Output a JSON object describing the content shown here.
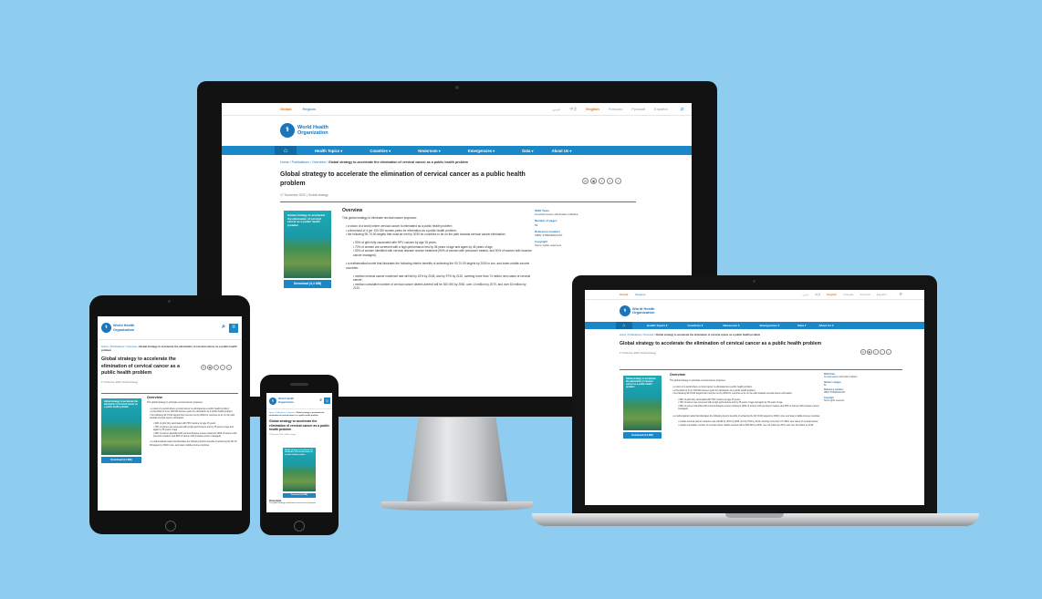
{
  "site": {
    "global_label": "Global",
    "regions_label": "Regions",
    "languages": [
      "عربي",
      "中文",
      "English",
      "Français",
      "Русский",
      "Español"
    ],
    "active_language": "English",
    "logo_line1": "World Health",
    "logo_line2": "Organization",
    "nav": [
      "Health Topics ▾",
      "Countries ▾",
      "Newsroom ▾",
      "Emergencies ▾",
      "Data ▾",
      "About Us ▾"
    ]
  },
  "page": {
    "breadcrumb_prefix": "Home / Publications / Overview / ",
    "breadcrumb_current": "Global strategy to accelerate the elimination of cervical cancer as a public health problem",
    "title": "Global strategy to accelerate the elimination of cervical cancer as a public health problem",
    "meta": "17 November 2020 | Global strategy",
    "cover_text": "Global strategy to accelerate the elimination of cervical cancer as a public health problem",
    "download_label": "Download (3,4 MB)",
    "overview_heading": "Overview",
    "overview_intro": "This global strategy to eliminate cervical cancer proposes:",
    "bullets": [
      "a vision of a world where cervical cancer is eliminated as a public health problem;",
      "a threshold of 4 per 100 000 women-years for elimination as a public health problem;",
      "the following 90-70-90 targets that must be met by 2030 for countries to be on the path towards cervical cancer elimination:"
    ],
    "sub_bullets": [
      "90% of girls fully vaccinated with HPV vaccine by age 15 years;",
      "70% of women are screened with a high-performance test by 35 years of age and again by 45 years of age",
      "90% of women identified with cervical disease receive treatment (90% of women with precancer treated, and 90% of women with invasive cancer managed)."
    ],
    "model_bullet": "a mathematical model that illustrates the following interim benefits of achieving the 90-70-90 targets by 2030 in low- and lower-middle-income countries:",
    "model_sub": [
      "median cervical cancer incidence rate will fall by 42% by 2045, and by 97% by 2120, averting more than 74 million new cases of cervical cancer;",
      "median cumulative number of cervical cancer deaths averted will be 300 000 by 2030, over 14 million by 2070, and over 62 million by 2120."
    ],
    "side": {
      "team_label": "WHO Team",
      "team_value": "Cervical cancer elimination initiative",
      "pages_label": "Number of pages",
      "pages_value": "52",
      "ref_label": "Reference numbers",
      "ref_value": "ISBN: 9789240014107",
      "copyright_label": "Copyright",
      "copyright_value": "Some rights reserved."
    },
    "share_icons": [
      "✉",
      "▣",
      "f",
      "t",
      "+"
    ]
  }
}
